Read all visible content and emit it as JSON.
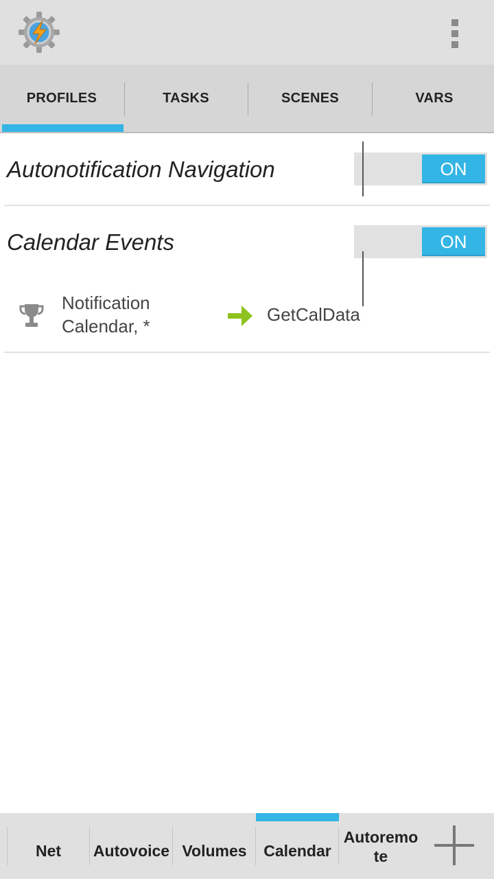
{
  "top_tabs": [
    {
      "label": "PROFILES",
      "active": true
    },
    {
      "label": "TASKS",
      "active": false
    },
    {
      "label": "SCENES",
      "active": false
    },
    {
      "label": "VARS",
      "active": false
    }
  ],
  "profiles": [
    {
      "name": "Autonotification Navigation",
      "toggle": "ON"
    },
    {
      "name": "Calendar Events",
      "toggle": "ON",
      "context": {
        "icon": "trophy-icon",
        "label": "Notification Calendar, *"
      },
      "task": {
        "icon": "arrow-right-icon",
        "label": "GetCalData"
      }
    }
  ],
  "bottom_tabs": [
    {
      "label": "Net",
      "active": false
    },
    {
      "label": "Autovoice",
      "active": false
    },
    {
      "label": "Volumes",
      "active": false
    },
    {
      "label": "Calendar",
      "active": true
    },
    {
      "label": "Autoremote",
      "active": false
    }
  ],
  "icons": {
    "app": "tasker-gear-bolt-icon",
    "menu": "overflow-menu-icon",
    "add": "plus-icon"
  },
  "colors": {
    "accent": "#33b5e5",
    "task_arrow": "#8dc21f"
  }
}
